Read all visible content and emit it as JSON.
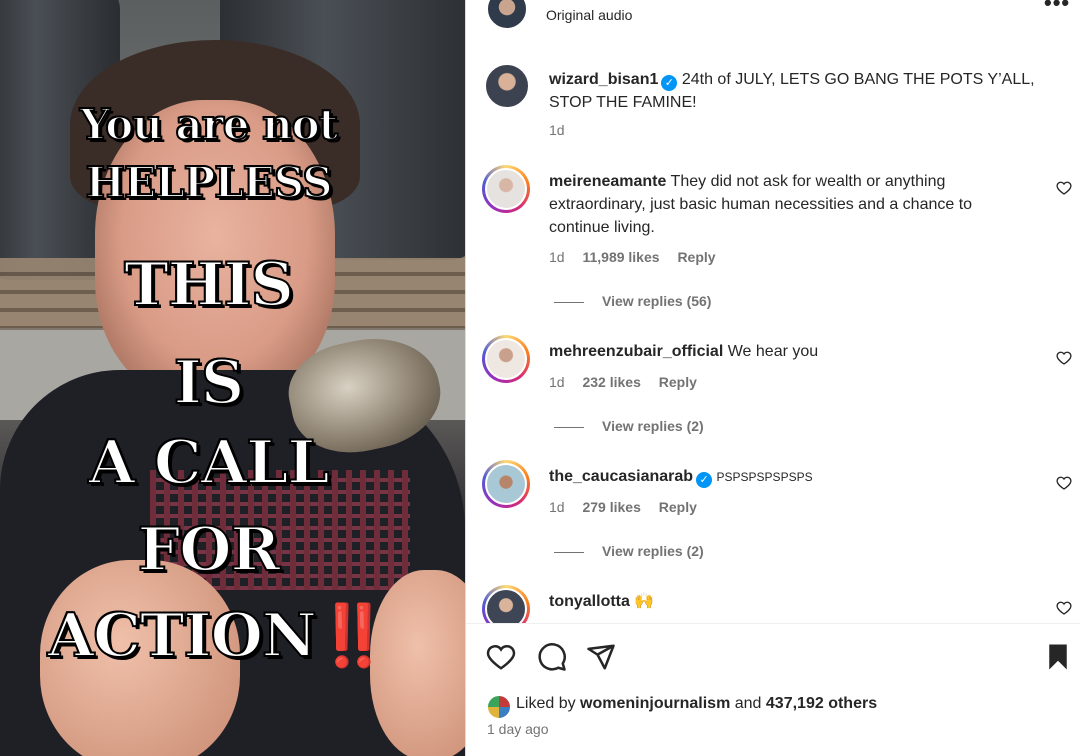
{
  "video": {
    "overlay_lines": [
      "You are not",
      "HELPLESS",
      "THIS",
      "IS",
      "A CALL",
      "FOR",
      "ACTION"
    ],
    "overlay_emoji": "‼️"
  },
  "header": {
    "audio_label": "Original audio",
    "more_label": "•••"
  },
  "caption": {
    "username": "wizard_bisan1",
    "text": "24th of JULY, LETS GO BANG THE POTS Y’ALL, STOP THE FAMINE!",
    "time": "1d"
  },
  "comments": [
    {
      "username": "meireneamante",
      "text": "They did not ask for wealth or anything extraordinary, just basic human necessities and a chance to continue living.",
      "time": "1d",
      "likes": "11,989 likes",
      "reply": "Reply",
      "view_replies": "View replies (56)"
    },
    {
      "username": "mehreenzubair_official",
      "text": "We hear you",
      "time": "1d",
      "likes": "232 likes",
      "reply": "Reply",
      "view_replies": "View replies (2)"
    },
    {
      "username": "the_caucasianarab",
      "verified": true,
      "text": "PSPSPSPSPSPS",
      "time": "1d",
      "likes": "279 likes",
      "reply": "Reply",
      "view_replies": "View replies (2)"
    },
    {
      "username": "tonyallotta",
      "text": "🙌"
    }
  ],
  "footer": {
    "liked_prefix": "Liked by",
    "liked_user": "womeninjournalism",
    "liked_and": "and",
    "liked_others": "437,192 others",
    "time_ago": "1 day ago"
  },
  "colors": {
    "verified": "#0095f6",
    "muted_text": "#737373",
    "primary_text": "#262626"
  }
}
